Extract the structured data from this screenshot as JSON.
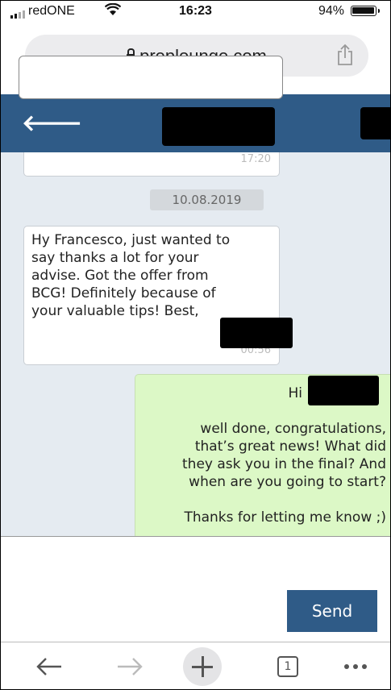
{
  "status_bar": {
    "carrier": "redONE",
    "time": "16:23",
    "battery_percent": "94%",
    "battery_level": 0.94
  },
  "browser": {
    "url": "preplounge.com"
  },
  "chat": {
    "top_timestamp": "17:20",
    "date_divider": "10.08.2019",
    "incoming_message": {
      "text": "Hy Francesco, just wanted to\nsay thanks a lot for your\nadvise. Got the offer from\nBCG! Definitely because of\nyour valuable tips! Best,",
      "time": "00:56"
    },
    "outgoing_message": {
      "greeting": "Hi",
      "text": "well done, congratulations,\nthat’s great news! What did\nthey ask you in the final? And\nwhen are you going to start?\n\nThanks for letting me know ;)"
    }
  },
  "composer": {
    "placeholder": "",
    "send_label": "Send"
  },
  "toolbar": {
    "tab_count": "1"
  },
  "colors": {
    "header": "#2f5b87",
    "chat_background": "#e5ebf1",
    "outgoing_bubble": "#dcf8c6",
    "send_button": "#2f5b87"
  }
}
